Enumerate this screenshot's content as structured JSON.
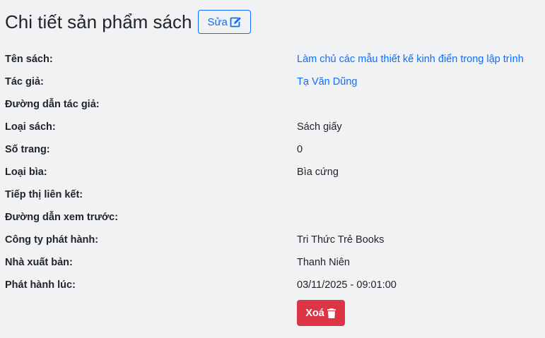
{
  "header": {
    "title": "Chi tiết sản phẩm sách",
    "edit_label": "Sửa",
    "edit_icon": "edit-square-icon"
  },
  "details": [
    {
      "label": "Tên sách:",
      "value": "Làm chủ các mẫu thiết kế kinh điển trong lập trình",
      "link": true
    },
    {
      "label": "Tác giả:",
      "value": "Tạ Văn Dũng",
      "link": true
    },
    {
      "label": "Đường dẫn tác giả:",
      "value": "",
      "link": false
    },
    {
      "label": "Loại sách:",
      "value": "Sách giấy",
      "link": false
    },
    {
      "label": "Số trang:",
      "value": "0",
      "link": false
    },
    {
      "label": "Loại bìa:",
      "value": "Bìa cứng",
      "link": false
    },
    {
      "label": "Tiếp thị liên kết:",
      "value": "",
      "link": false
    },
    {
      "label": "Đường dẫn xem trước:",
      "value": "",
      "link": false
    },
    {
      "label": "Công ty phát hành:",
      "value": "Tri Thức Trẻ Books",
      "link": false
    },
    {
      "label": "Nhà xuất bản:",
      "value": "Thanh Niên",
      "link": false
    },
    {
      "label": "Phát hành lúc:",
      "value": "03/11/2025 - 09:01:00",
      "link": false
    }
  ],
  "actions": {
    "delete_label": "Xoá",
    "delete_icon": "trash-icon"
  },
  "colors": {
    "primary": "#0d6efd",
    "danger": "#dc3545",
    "background": "#f1f2f4",
    "text": "#212529"
  }
}
